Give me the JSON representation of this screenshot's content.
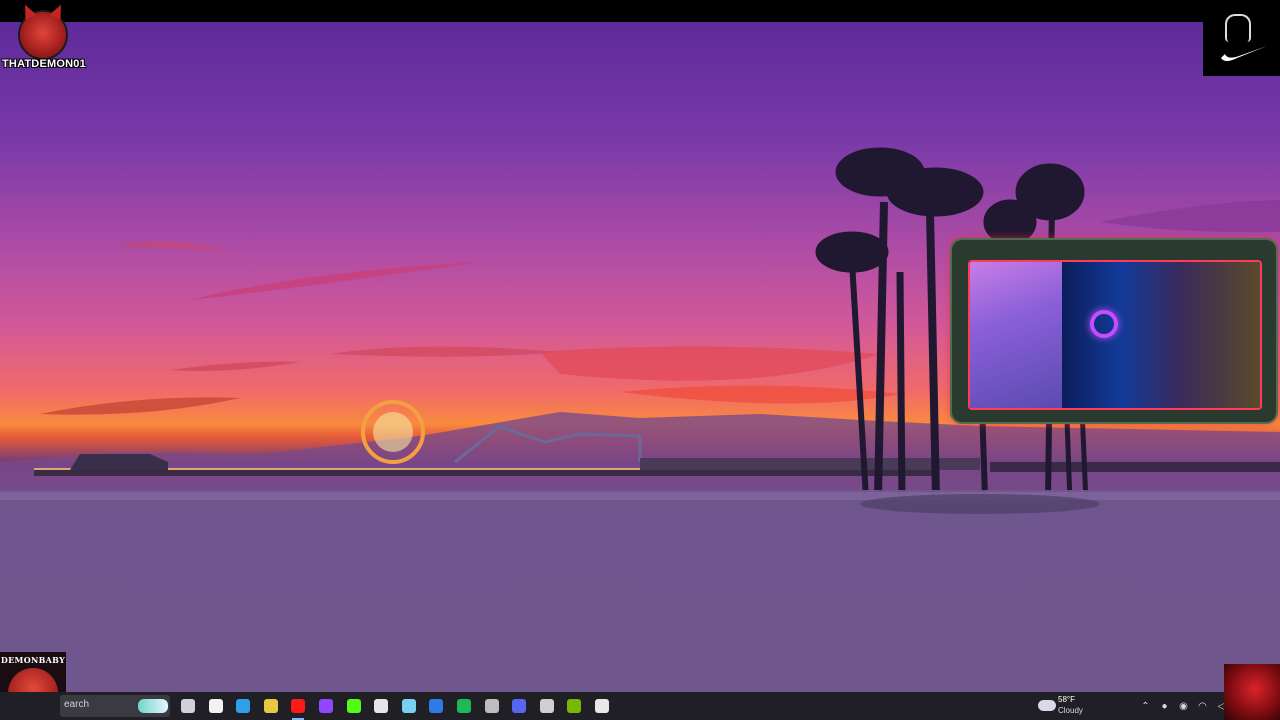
{
  "overlays": {
    "top_left_logo_text": "THATDEMON01",
    "bottom_left_logo_text": "DEMONBABY"
  },
  "taskbar": {
    "search_label": "earch",
    "pinned": [
      {
        "name": "task-view-icon",
        "color": "#d0d0d8"
      },
      {
        "name": "microsoft-store-icon",
        "color": "#f2f2f2"
      },
      {
        "name": "edge-icon",
        "color": "#2ea0e8"
      },
      {
        "name": "chrome-icon",
        "color": "#e8c840"
      },
      {
        "name": "youtube-icon",
        "color": "#ff1a1a",
        "active": true
      },
      {
        "name": "twitch-icon",
        "color": "#9146ff"
      },
      {
        "name": "kick-icon",
        "color": "#53fc18"
      },
      {
        "name": "streamlabs-icon",
        "color": "#e6e6e6"
      },
      {
        "name": "steam-icon",
        "color": "#7ad0f0"
      },
      {
        "name": "vpn-icon",
        "color": "#2e7ae8"
      },
      {
        "name": "spotify-icon",
        "color": "#1db954"
      },
      {
        "name": "obs-icon",
        "color": "#bdbdbd"
      },
      {
        "name": "discord-icon",
        "color": "#5865f2"
      },
      {
        "name": "game-icon",
        "color": "#cfcfcf"
      },
      {
        "name": "nvidia-icon",
        "color": "#76b900"
      },
      {
        "name": "update-icon",
        "color": "#e8e8e8"
      }
    ]
  },
  "weather": {
    "temp": "58°F",
    "condition": "Cloudy"
  },
  "tray": {
    "icons": [
      "chevron-up-icon",
      "mic-icon",
      "vpn-tray-icon",
      "wifi-icon",
      "volume-icon"
    ]
  }
}
